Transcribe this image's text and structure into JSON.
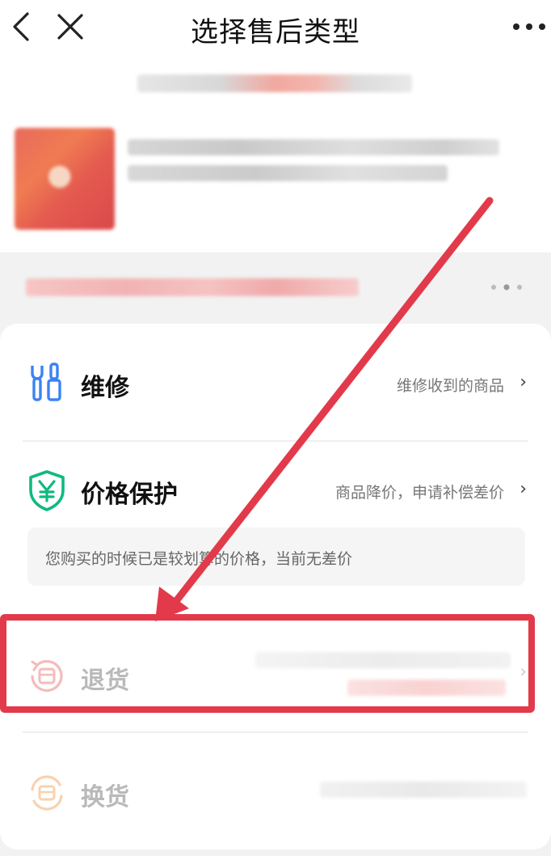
{
  "header": {
    "title": "选择售后类型",
    "back_icon": "chevron-left-icon",
    "close_icon": "close-icon",
    "more_icon": "more-horizontal-icon"
  },
  "product": {
    "status_more_icon": "more-dots-icon"
  },
  "options": [
    {
      "key": "repair",
      "label": "维修",
      "description": "维修收到的商品",
      "icon": "wrench-screwdriver-icon",
      "chevron": "›",
      "color": "#3b82f6"
    },
    {
      "key": "price-protect",
      "label": "价格保护",
      "description": "商品降价，申请补偿差价",
      "icon": "yen-shield-icon",
      "chevron": "›",
      "color": "#10b981",
      "note": "您购买的时候已是较划算的价格，当前无差价"
    },
    {
      "key": "return",
      "label": "退货",
      "icon": "return-box-icon",
      "chevron": "›",
      "color": "#f5a3a3"
    },
    {
      "key": "exchange",
      "label": "换货",
      "icon": "exchange-box-icon",
      "color": "#f7c79b"
    }
  ],
  "colors": {
    "annotation_red": "#e23a4a"
  }
}
